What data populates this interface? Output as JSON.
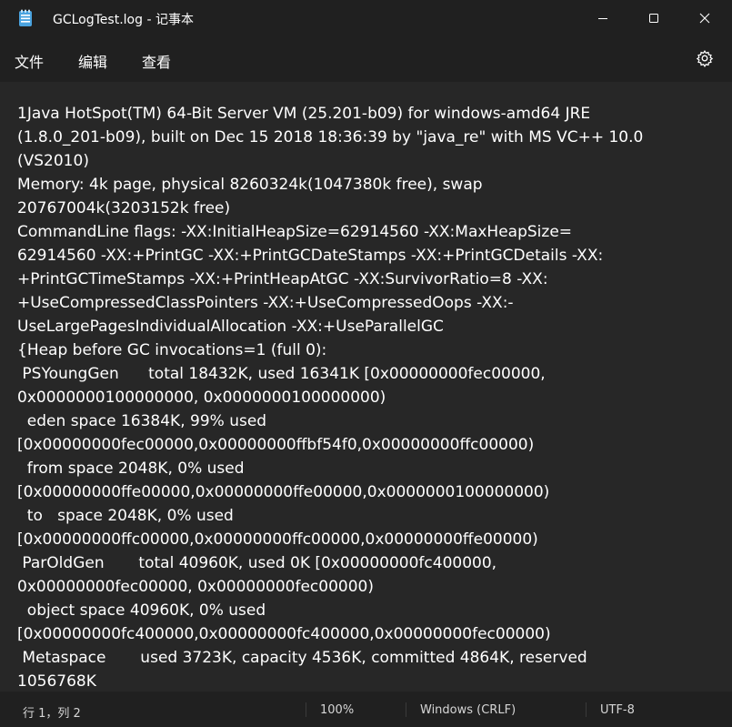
{
  "window": {
    "title": "GCLogTest.log - 记事本"
  },
  "menu": {
    "file": "文件",
    "edit": "编辑",
    "view": "查看"
  },
  "editor": {
    "lines": [
      "1Java HotSpot(TM) 64-Bit Server VM (25.201-b09) for windows-amd64 JRE",
      "(1.8.0_201-b09), built on Dec 15 2018 18:36:39 by \"java_re\" with MS VC++ 10.0",
      "(VS2010)",
      "Memory: 4k page, physical 8260324k(1047380k free), swap",
      "20767004k(3203152k free)",
      "CommandLine flags: -XX:InitialHeapSize=62914560 -XX:MaxHeapSize=",
      "62914560 -XX:+PrintGC -XX:+PrintGCDateStamps -XX:+PrintGCDetails -XX:",
      "+PrintGCTimeStamps -XX:+PrintHeapAtGC -XX:SurvivorRatio=8 -XX:",
      "+UseCompressedClassPointers -XX:+UseCompressedOops -XX:-",
      "UseLargePagesIndividualAllocation -XX:+UseParallelGC",
      "{Heap before GC invocations=1 (full 0):",
      " PSYoungGen      total 18432K, used 16341K [0x00000000fec00000,",
      "0x0000000100000000, 0x0000000100000000)",
      "  eden space 16384K, 99% used",
      "[0x00000000fec00000,0x00000000ffbf54f0,0x00000000ffc00000)",
      "  from space 2048K, 0% used",
      "[0x00000000ffe00000,0x00000000ffe00000,0x0000000100000000)",
      "  to   space 2048K, 0% used",
      "[0x00000000ffc00000,0x00000000ffc00000,0x00000000ffe00000)",
      " ParOldGen       total 40960K, used 0K [0x00000000fc400000,",
      "0x00000000fec00000, 0x00000000fec00000)",
      "  object space 40960K, 0% used",
      "[0x00000000fc400000,0x00000000fc400000,0x00000000fec00000)",
      " Metaspace       used 3723K, capacity 4536K, committed 4864K, reserved",
      "1056768K"
    ]
  },
  "status": {
    "position": "行 1，列 2",
    "zoom": "100%",
    "line_ending": "Windows (CRLF)",
    "encoding": "UTF-8"
  },
  "icons": {
    "app": "notepad-icon",
    "minimize": "minimize-icon",
    "maximize": "maximize-icon",
    "close": "close-icon",
    "settings": "gear-icon"
  },
  "colors": {
    "accent": "#4aa3df"
  }
}
